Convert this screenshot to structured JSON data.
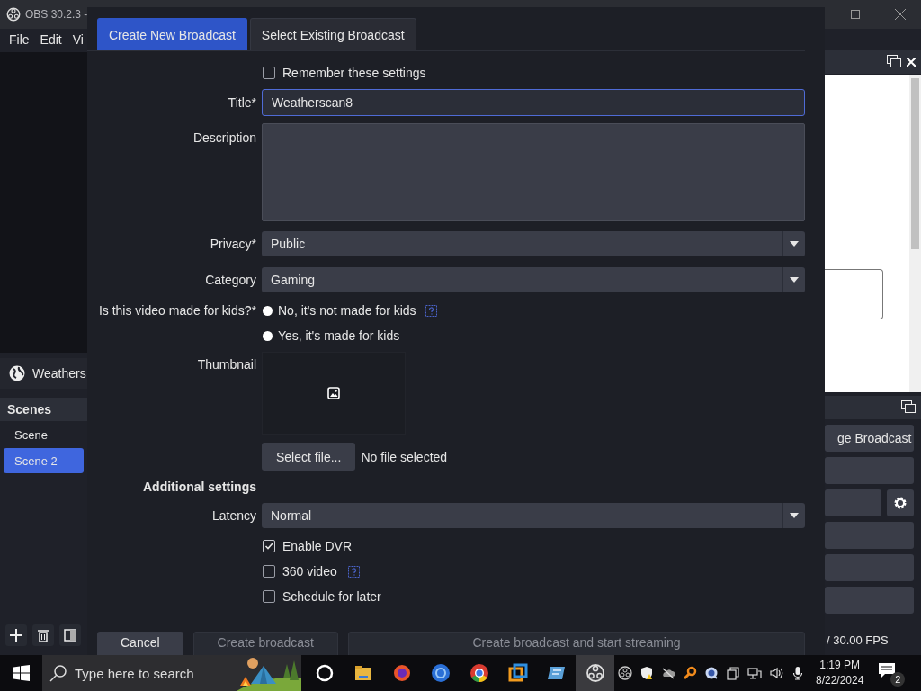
{
  "obs_window": {
    "title": "OBS 30.2.3 -",
    "menu": [
      "File",
      "Edit",
      "Vi"
    ],
    "sources": [
      {
        "name": "Weathers"
      }
    ],
    "scenes": {
      "title": "Scenes",
      "items": [
        {
          "name": "Scene",
          "selected": false
        },
        {
          "name": "Scene 2",
          "selected": true
        }
      ]
    },
    "controls_dock": {
      "buttons": [
        {
          "kind": "text",
          "label": "ge Broadcast"
        },
        {
          "kind": "blank"
        },
        {
          "kind": "settings"
        },
        {
          "kind": "blank"
        },
        {
          "kind": "blank"
        },
        {
          "kind": "blank"
        }
      ]
    },
    "status_bar": {
      "fps": "/ 30.00 FPS"
    }
  },
  "dialog": {
    "tabs": [
      {
        "label": "Create New Broadcast",
        "selected": true
      },
      {
        "label": "Select Existing Broadcast",
        "selected": false
      }
    ],
    "remember": {
      "label": "Remember these settings",
      "checked": false
    },
    "title_field": {
      "label": "Title*",
      "value": "Weatherscan8"
    },
    "description": {
      "label": "Description"
    },
    "privacy": {
      "label": "Privacy*",
      "value": "Public"
    },
    "category": {
      "label": "Category",
      "value": "Gaming"
    },
    "kids": {
      "label": "Is this video made for kids?*",
      "options": [
        {
          "label": "No, it's not made for kids",
          "selected": false,
          "help": true
        },
        {
          "label": "Yes, it's made for kids",
          "selected": false,
          "help": false
        }
      ]
    },
    "thumbnail": {
      "label": "Thumbnail",
      "button": "Select file...",
      "status": "No file selected"
    },
    "additional_settings": "Additional settings",
    "latency": {
      "label": "Latency",
      "value": "Normal"
    },
    "options": [
      {
        "label": "Enable DVR",
        "checked": true,
        "help": false
      },
      {
        "label": "360 video",
        "checked": false,
        "help": true
      },
      {
        "label": "Schedule for later",
        "checked": false,
        "help": false
      }
    ],
    "buttons": [
      {
        "label": "Cancel",
        "disabled": false
      },
      {
        "label": "Create broadcast",
        "disabled": true
      },
      {
        "label": "Create broadcast and start streaming",
        "disabled": true
      }
    ]
  },
  "taskbar": {
    "search": {
      "placeholder": "Type here to search"
    },
    "apps": [
      {
        "selected": false
      },
      {
        "selected": false
      },
      {
        "selected": false
      },
      {
        "selected": false
      },
      {
        "selected": false
      },
      {
        "selected": false
      },
      {
        "selected": false
      },
      {
        "selected": true
      }
    ],
    "time": "1:19 PM",
    "date": "8/22/2024",
    "notifications": "2"
  }
}
